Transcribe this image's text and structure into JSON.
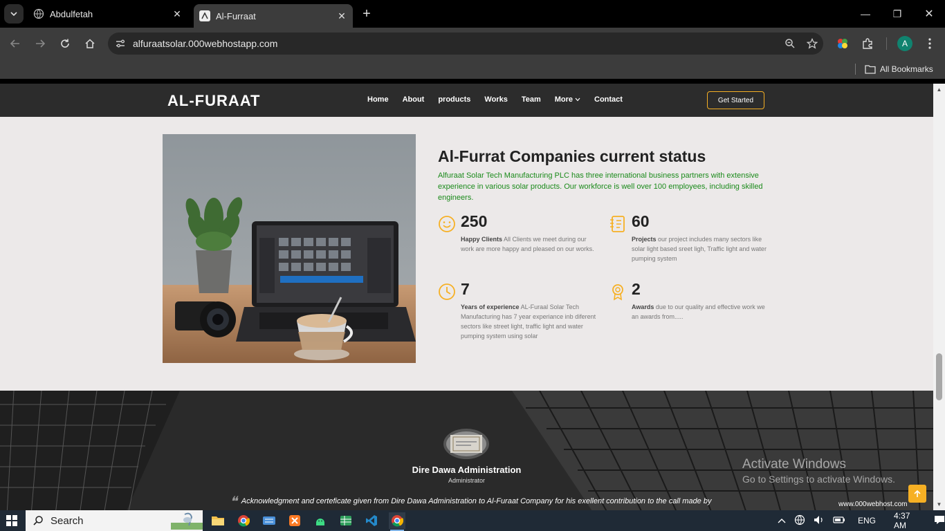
{
  "browser": {
    "tabs": [
      {
        "title": "Abdulfetah",
        "active": false
      },
      {
        "title": "Al-Furraat",
        "active": true
      }
    ],
    "url": "alfuraatsolar.000webhostapp.com",
    "bookmarks_label": "All Bookmarks",
    "profile_initial": "A"
  },
  "site": {
    "logo": "AL-FURAAT",
    "menu": [
      "Home",
      "About",
      "products",
      "Works",
      "Team",
      "More",
      "Contact"
    ],
    "cta": "Get Started"
  },
  "status": {
    "title": "Al-Furrat Companies current status",
    "description": "Alfuraat Solar Tech Manufacturing PLC has three international business partners with extensive experience in various solar products. Our workforce is well over 100 employees, including skilled engineers.",
    "stats": [
      {
        "number": "250",
        "label": "Happy Clients",
        "text": "All Clients we meet during our work are more happy and pleased on our works.",
        "icon": "smiley-icon"
      },
      {
        "number": "60",
        "label": "Projects",
        "text": "our project includes many sectors like solar light based sreet ligh, Traffic light and water pumping system",
        "icon": "notebook-icon"
      },
      {
        "number": "7",
        "label": "Years of experience",
        "text": "AL-Furaal Solar Tech Manufacturing has 7 year experiance inb diferent sectors like street light, traffic light and water pumping system using solar",
        "icon": "clock-icon"
      },
      {
        "number": "2",
        "label": "Awards",
        "text": "due to our quality and effective work we an awards from.....",
        "icon": "award-icon"
      }
    ]
  },
  "testimonial": {
    "name": "Dire Dawa Administration",
    "role": "Administrator",
    "quote": "Acknowledgment and certeficate given from Dire Dawa Administration to Al-Furaat Company for his exellent contribution to the call made by"
  },
  "overlay": {
    "activate_title": "Activate Windows",
    "activate_sub": "Go to Settings to activate Windows.",
    "host_badge": "www.000webhost.com"
  },
  "taskbar": {
    "search_label": "Search",
    "language": "ENG",
    "time": "4:37 AM"
  },
  "colors": {
    "accent": "#f6b024",
    "header_bg": "#2c2c2c",
    "desc_green": "#1a8a1a"
  }
}
